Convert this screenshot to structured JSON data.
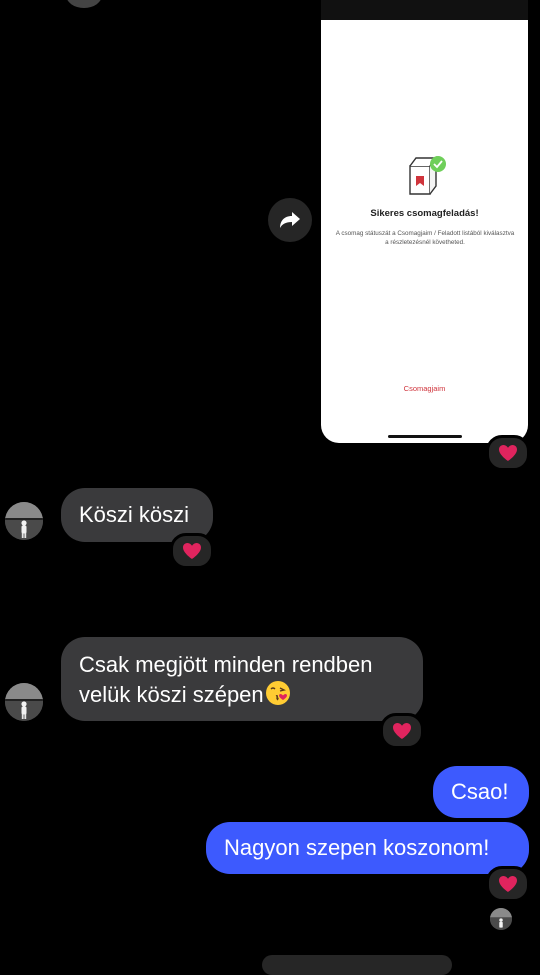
{
  "shared_screenshot": {
    "title": "Sikeres csomagfeladás!",
    "description": "A csomag státuszát a Csomagjaim / Feladott listából kiválasztva a részletezésnél követheted.",
    "link_label": "Csomagjaim",
    "reaction": "❤️"
  },
  "messages": [
    {
      "from": "them",
      "text": "Köszi köszi",
      "reaction": "❤️"
    },
    {
      "from": "them",
      "line1": "Csak megjött minden rendben",
      "line2": "velük köszi szépen",
      "emoji": "face-blowing-a-kiss",
      "reaction": "❤️"
    },
    {
      "from": "me",
      "text": "Csao!"
    },
    {
      "from": "me",
      "text": "Nagyon szepen koszonom!",
      "reaction": "❤️"
    }
  ],
  "colors": {
    "background": "#000000",
    "incoming_bubble": "#3a3a3c",
    "outgoing_bubble": "#3d5afe",
    "heart": "#e0245e",
    "link": "#d0343c"
  }
}
